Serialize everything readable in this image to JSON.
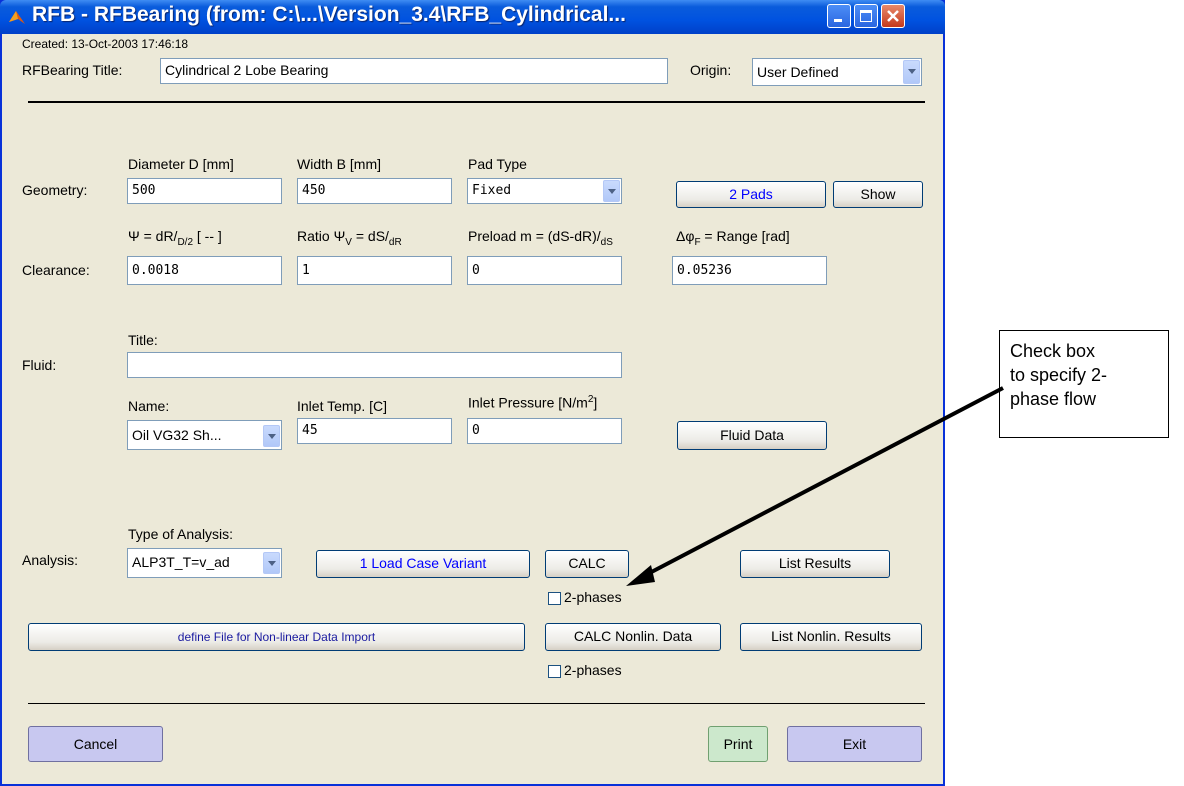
{
  "window": {
    "title": "RFB - RFBearing (from: C:\\...\\Version_3.4\\RFB_Cylindrical...",
    "created": "Created: 13-Oct-2003 17:46:18"
  },
  "header": {
    "title_label": "RFBearing Title:",
    "title_value": "Cylindrical 2 Lobe Bearing",
    "origin_label": "Origin:",
    "origin_value": "User Defined"
  },
  "geometry": {
    "section_label": "Geometry:",
    "diameter_label": "Diameter D [mm]",
    "diameter_value": "500",
    "width_label": "Width B [mm]",
    "width_value": "450",
    "pad_type_label": "Pad Type",
    "pad_type_value": "Fixed",
    "pads_button": "2 Pads",
    "show_button": "Show"
  },
  "clearance": {
    "section_label": "Clearance:",
    "psi_label": "Ψ = dR/",
    "psi_sub": "D/2",
    "psi_tail": " [ -- ]",
    "ratio_label": "Ratio Ψ",
    "ratio_sub1": "V",
    "ratio_mid": " = dS/",
    "ratio_sub2": "dR",
    "preload_label": "Preload m = (dS-dR)/",
    "preload_sub": "dS",
    "range_label": "Δφ",
    "range_sub": "F",
    "range_tail": " = Range [rad]",
    "psi_value": "0.0018",
    "ratio_value": "1",
    "preload_value": "0",
    "range_value": "0.05236"
  },
  "fluid": {
    "section_label": "Fluid:",
    "title_label": "Title:",
    "title_value": "",
    "name_label": "Name:",
    "name_value": "Oil VG32 Sh...",
    "inlet_temp_label": "Inlet Temp. [C]",
    "inlet_temp_value": "45",
    "inlet_pressure_label": "Inlet Pressure [N/m",
    "inlet_pressure_sup": "2",
    "inlet_pressure_tail": "]",
    "inlet_pressure_value": "0",
    "fluid_data_button": "Fluid Data"
  },
  "analysis": {
    "section_label": "Analysis:",
    "type_label": "Type of Analysis:",
    "type_value": "ALP3T_T=v_ad",
    "load_case_button": "1 Load Case Variant",
    "calc_button": "CALC",
    "list_results_button": "List Results",
    "two_phases_label": "2-phases",
    "nonlinear_file_button": "define File for Non-linear Data Import",
    "calc_nonlin_button": "CALC Nonlin. Data",
    "list_nonlin_button": "List Nonlin. Results",
    "two_phases_label_2": "2-phases"
  },
  "footer": {
    "cancel_button": "Cancel",
    "print_button": "Print",
    "exit_button": "Exit"
  },
  "callout": {
    "text": "Check box to specify 2-phase flow",
    "lines": [
      "Check box",
      "to specify 2-",
      "phase flow"
    ]
  },
  "colors": {
    "titlebar": "#0052e0",
    "dialog_bg": "#ece9d8",
    "blue_text": "#0000ff",
    "cancel_exit_bg": "#c8c8f0",
    "print_bg": "#cce8cc"
  }
}
